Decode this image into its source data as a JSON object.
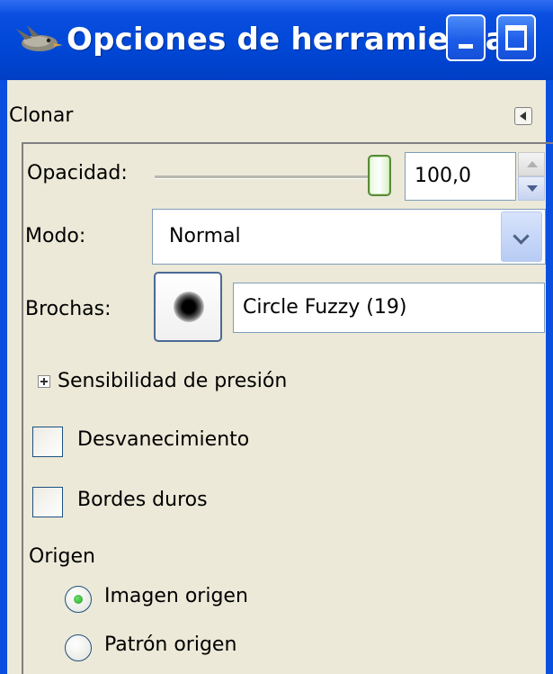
{
  "window": {
    "title": "Opciones de herramienta",
    "icons": [
      "gimp-wilber-icon",
      "minimize-icon",
      "maximize-icon"
    ],
    "colors": {
      "title_bar": "#0047d6",
      "background": "#ece9d8"
    }
  },
  "panel": {
    "title": "Clonar",
    "menu_icon": "panel-menu-arrow-icon"
  },
  "opacity": {
    "label": "Opacidad:",
    "value": "100,0",
    "slider_fraction": 1.0
  },
  "mode": {
    "label": "Modo:",
    "selected": "Normal"
  },
  "brush": {
    "label": "Brochas:",
    "name": "Circle Fuzzy (19)"
  },
  "pressure": {
    "label": "Sensibilidad de presión",
    "expanded": false
  },
  "options": {
    "fade_label": "Desvanecimiento",
    "fade_checked": false,
    "hard_edges_label": "Bordes duros",
    "hard_edges_checked": false
  },
  "source": {
    "label": "Origen",
    "options": [
      {
        "label": "Imagen origen",
        "selected": true
      },
      {
        "label": "Patrón origen",
        "selected": false
      }
    ]
  }
}
